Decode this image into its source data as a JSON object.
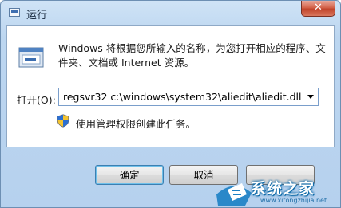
{
  "window": {
    "title": "运行",
    "close_symbol": "✕"
  },
  "dialog": {
    "description": "Windows 将根据您所输入的名称，为您打开相应的程序、文件夹、文档或 Internet 资源。",
    "open_label": "打开(O):",
    "command_value": "regsvr32 c:\\windows\\system32\\aliedit\\aliedit.dll",
    "admin_note": "使用管理权限创建此任务。"
  },
  "buttons": {
    "ok": "确定",
    "cancel": "取消",
    "browse": ""
  },
  "watermark": {
    "text": "系统之家",
    "url": "www.xitongzhijia.net"
  }
}
